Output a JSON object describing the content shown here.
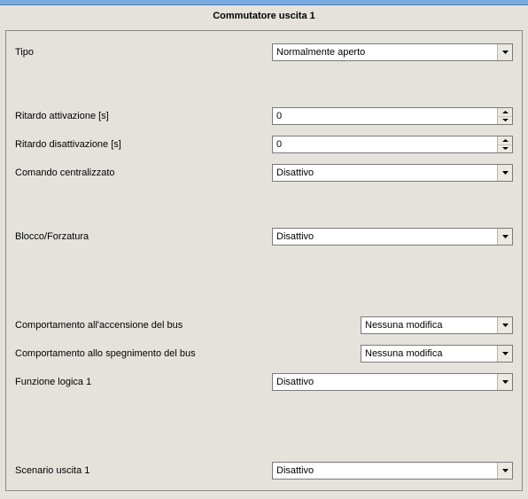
{
  "heading": "Commutatore uscita 1",
  "rows": {
    "tipo": {
      "label": "Tipo",
      "value": "Normalmente aperto"
    },
    "ritAtt": {
      "label": "Ritardo attivazione [s]",
      "value": "0"
    },
    "ritDis": {
      "label": "Ritardo disattivazione [s]",
      "value": "0"
    },
    "comCent": {
      "label": "Comando centralizzato",
      "value": "Disattivo"
    },
    "blocco": {
      "label": "Blocco/Forzatura",
      "value": "Disattivo"
    },
    "busOn": {
      "label": "Comportamento all'accensione del bus",
      "value": "Nessuna modifica"
    },
    "busOff": {
      "label": "Comportamento allo spegnimento del bus",
      "value": "Nessuna modifica"
    },
    "logica": {
      "label": "Funzione logica 1",
      "value": "Disattivo"
    },
    "scenario": {
      "label": "Scenario uscita 1",
      "value": "Disattivo"
    }
  }
}
